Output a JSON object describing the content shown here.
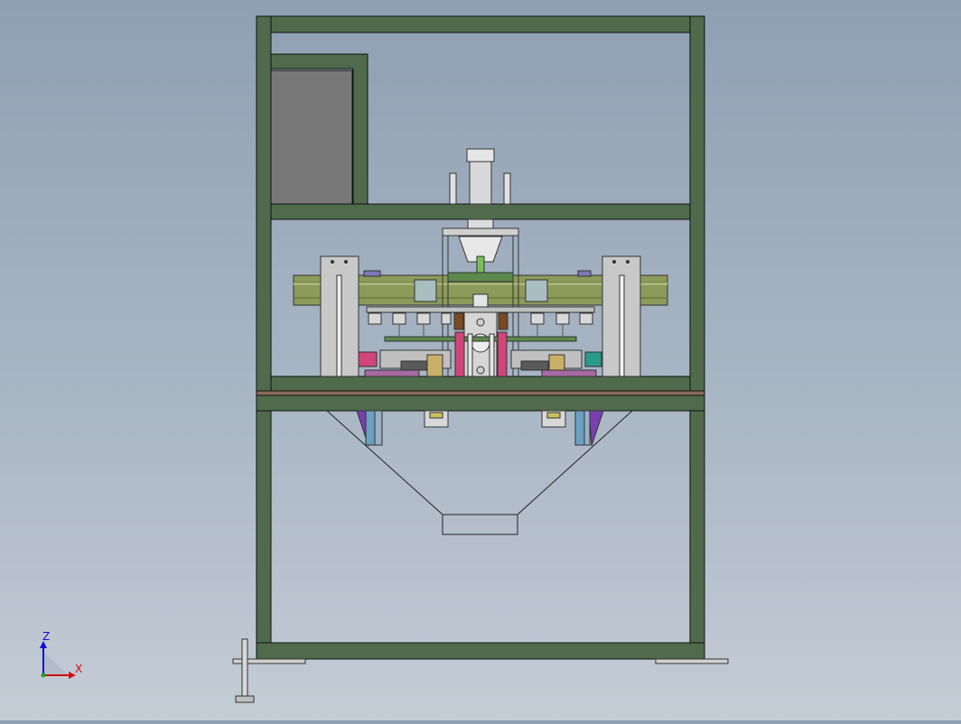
{
  "window": {
    "background_top": "#8fa0b3",
    "background_bottom": "#c4ccd6"
  },
  "model": {
    "frame_color": "#4f6b4c",
    "panel_color": "#787878",
    "rail_color": "#8c9a5a",
    "bracket_color": "#c8c8c8",
    "accent_colors": [
      "#d0457a",
      "#7b3fb0",
      "#3aa0a0",
      "#6aa0c0"
    ]
  },
  "triad": {
    "x_label": "X",
    "z_label": "Z",
    "x_color": "#d01010",
    "z_color": "#1010d0",
    "origin_color": "#20a020"
  }
}
